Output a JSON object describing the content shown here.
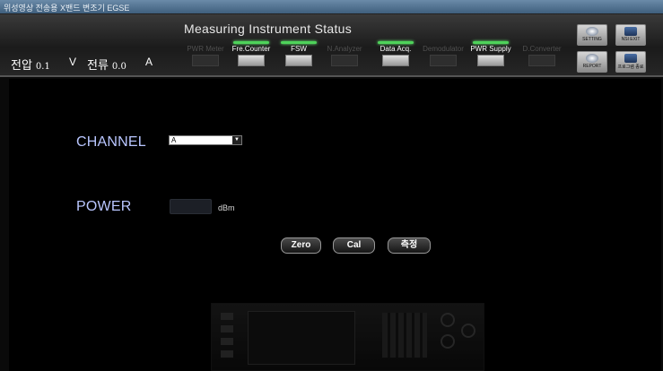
{
  "window": {
    "title": "위성영상 전송용 X밴드 변조기 EGSE"
  },
  "header": {
    "title": "Measuring Instrument Status",
    "voltage": {
      "label": "전압",
      "value": "0.1",
      "unit": "V"
    },
    "current": {
      "label": "전류",
      "value": "0.0",
      "unit": "A"
    }
  },
  "instruments": [
    {
      "label": "PWR Meter",
      "active": false
    },
    {
      "label": "Fre.Counter",
      "active": true
    },
    {
      "label": "FSW",
      "active": true
    },
    {
      "label": "N.Analyzer",
      "active": false
    },
    {
      "label": "Data Acq.",
      "active": true
    },
    {
      "label": "Demodulator",
      "active": false
    },
    {
      "label": "PWR Supply",
      "active": true
    },
    {
      "label": "D.Converter",
      "active": false
    }
  ],
  "toolbar": {
    "setting": "SETTING",
    "nsi": "NSI EXIT",
    "report": "REPORT",
    "exit": "프로그램 종료"
  },
  "main": {
    "channel_label": "CHANNEL",
    "channel_value": "A",
    "power_label": "POWER",
    "power_value": "",
    "power_unit": "dBm",
    "zero_btn": "Zero",
    "cal_btn": "Cal",
    "measure_btn": "측정"
  },
  "colors": {
    "label": "#b9c6ff",
    "led_on": "#4ed25a"
  }
}
